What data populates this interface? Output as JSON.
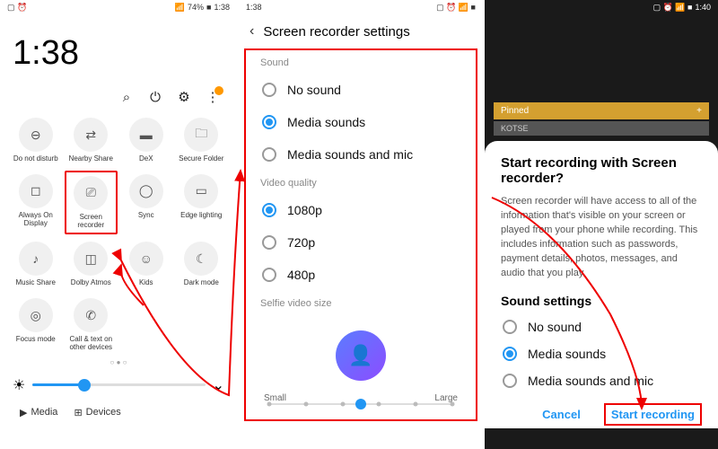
{
  "panel1": {
    "status": {
      "battery": "74%",
      "time": "1:38"
    },
    "clock": "1:38",
    "tiles": [
      {
        "icon": "⊖",
        "label": "Do not disturb"
      },
      {
        "icon": "⇄",
        "label": "Nearby Share"
      },
      {
        "icon": "▬",
        "label": "DeX"
      },
      {
        "icon": "🗀",
        "label": "Secure Folder"
      },
      {
        "icon": "◻",
        "label": "Always On Display"
      },
      {
        "icon": "⎚",
        "label": "Screen recorder"
      },
      {
        "icon": "◯",
        "label": "Sync"
      },
      {
        "icon": "▭",
        "label": "Edge lighting"
      },
      {
        "icon": "♪",
        "label": "Music Share"
      },
      {
        "icon": "◫",
        "label": "Dolby Atmos"
      },
      {
        "icon": "☺",
        "label": "Kids"
      },
      {
        "icon": "☾",
        "label": "Dark mode"
      },
      {
        "icon": "◎",
        "label": "Focus mode"
      },
      {
        "icon": "✆",
        "label": "Call & text on other devices"
      }
    ],
    "tabs": {
      "media": "Media",
      "devices": "Devices"
    }
  },
  "panel2": {
    "status": {
      "time": "1:38"
    },
    "title": "Screen recorder settings",
    "sound_label": "Sound",
    "sound_opts": [
      "No sound",
      "Media sounds",
      "Media sounds and mic"
    ],
    "sound_sel": 1,
    "video_label": "Video quality",
    "video_opts": [
      "1080p",
      "720p",
      "480p"
    ],
    "video_sel": 0,
    "selfie_label": "Selfie video size",
    "small": "Small",
    "large": "Large"
  },
  "panel3": {
    "status": {
      "time": "1:40"
    },
    "pinned": "Pinned",
    "kotse": "KOTSE",
    "dlg_title": "Start recording with Screen recorder?",
    "dlg_body": "Screen recorder will have access to all of the information that's visible on your screen or played from your phone while recording. This includes information such as passwords, payment details, photos, messages, and audio that you play.",
    "sound_title": "Sound settings",
    "sound_opts": [
      "No sound",
      "Media sounds",
      "Media sounds and mic"
    ],
    "sound_sel": 1,
    "cancel": "Cancel",
    "start": "Start recording"
  }
}
